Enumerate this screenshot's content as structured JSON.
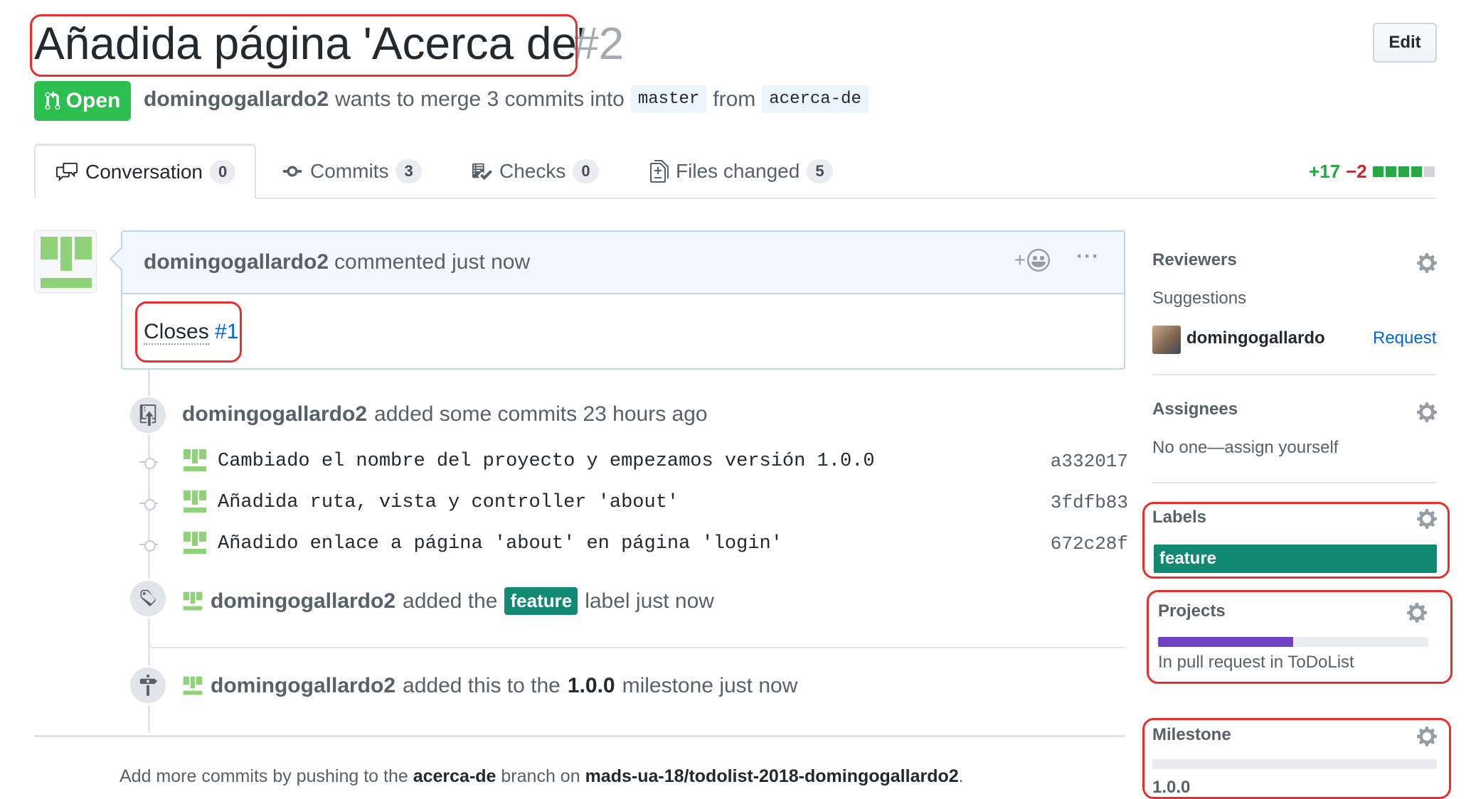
{
  "header": {
    "title": "Añadida página 'Acerca de'",
    "number": "#2",
    "edit_label": "Edit"
  },
  "status": {
    "state": "Open",
    "author": "domingogallardo2",
    "wants_to_merge": "wants to merge 3 commits into",
    "base_branch": "master",
    "from_word": "from",
    "head_branch": "acerca-de"
  },
  "tabs": [
    {
      "label": "Conversation",
      "count": "0",
      "icon": "comment-discussion-icon"
    },
    {
      "label": "Commits",
      "count": "3",
      "icon": "git-commit-icon"
    },
    {
      "label": "Checks",
      "count": "0",
      "icon": "checklist-icon"
    },
    {
      "label": "Files changed",
      "count": "5",
      "icon": "file-diff-icon"
    }
  ],
  "diffstat": {
    "additions": "+17",
    "deletions": "−2",
    "colors": {
      "add": "#28a745",
      "del": "#cb2431",
      "neutral": "#d1d5da"
    }
  },
  "comment": {
    "author": "domingogallardo2",
    "action": "commented just now",
    "body_text": "Closes",
    "body_link": "#1"
  },
  "timeline": {
    "commits_event": {
      "author": "domingogallardo2",
      "text": "added some commits 23 hours ago"
    },
    "commits": [
      {
        "message": "Cambiado el nombre del proyecto y empezamos versión 1.0.0",
        "sha": "a332017"
      },
      {
        "message": "Añadida ruta, vista y controller 'about'",
        "sha": "3fdfb83"
      },
      {
        "message": "Añadido enlace a página 'about' en página 'login'",
        "sha": "672c28f"
      }
    ],
    "label_event": {
      "author": "domingogallardo2",
      "before": "added the",
      "label": "feature",
      "after": "label just now"
    },
    "milestone_event": {
      "author": "domingogallardo2",
      "before": "added this to the",
      "milestone": "1.0.0",
      "after": "milestone just now"
    }
  },
  "footer": {
    "prefix": "Add more commits by pushing to the",
    "branch": "acerca-de",
    "middle": "branch on",
    "repo": "mads-ua-18/todolist-2018-domingogallardo2",
    "suffix": "."
  },
  "sidebar": {
    "reviewers": {
      "heading": "Reviewers",
      "suggestions_label": "Suggestions",
      "suggested_user": "domingogallardo",
      "request_label": "Request"
    },
    "assignees": {
      "heading": "Assignees",
      "empty_text": "No one—assign yourself"
    },
    "labels": {
      "heading": "Labels",
      "items": [
        "feature"
      ],
      "label_color": "#128a73"
    },
    "projects": {
      "heading": "Projects",
      "progress_fraction": 0.5,
      "status_text": "In pull request in ToDoList",
      "progress_color": "#6f42c1"
    },
    "milestone": {
      "heading": "Milestone",
      "progress_fraction": 0,
      "name": "1.0.0"
    }
  }
}
